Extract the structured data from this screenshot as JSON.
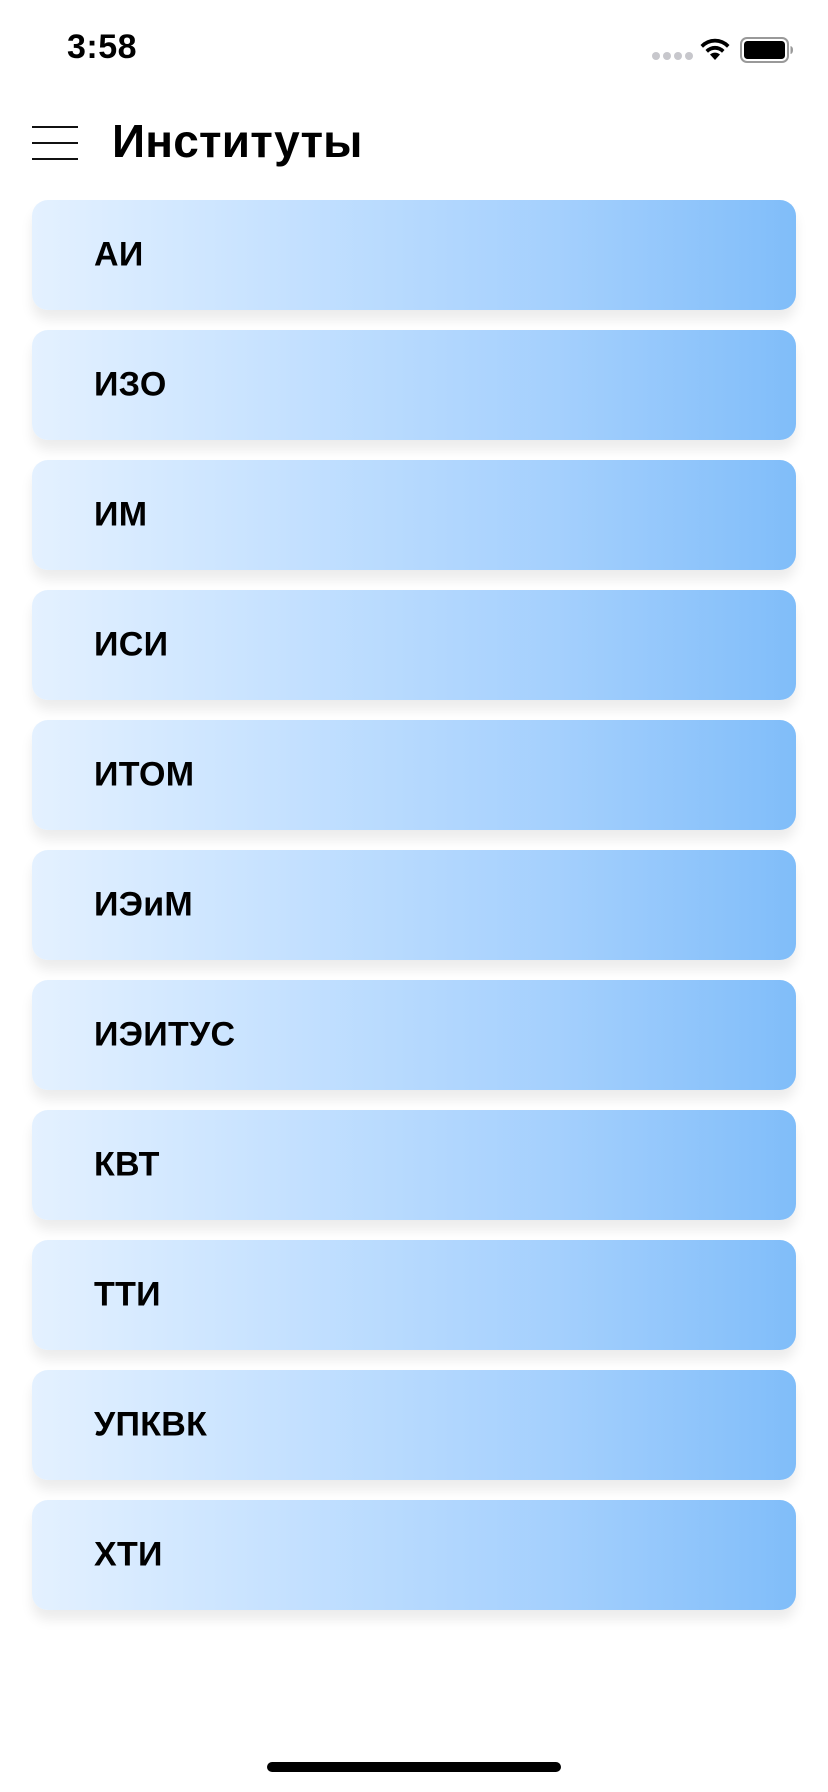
{
  "status_bar": {
    "time": "3:58",
    "icons": [
      "signal-dots-icon",
      "wifi-icon",
      "battery-icon"
    ]
  },
  "header": {
    "menu_icon": "hamburger-menu-icon",
    "title": "Институты"
  },
  "institutes": [
    {
      "label": "АИ"
    },
    {
      "label": "ИЗО"
    },
    {
      "label": "ИМ"
    },
    {
      "label": "ИСИ"
    },
    {
      "label": "ИТОМ"
    },
    {
      "label": "ИЭиМ"
    },
    {
      "label": "ИЭИТУС"
    },
    {
      "label": "КВТ"
    },
    {
      "label": "ТТИ"
    },
    {
      "label": "УПКВК"
    },
    {
      "label": "ХТИ"
    }
  ],
  "colors": {
    "card_gradient_start": "#e4f1ff",
    "card_gradient_end": "#80bdf9",
    "text": "#000000",
    "background": "#ffffff"
  }
}
